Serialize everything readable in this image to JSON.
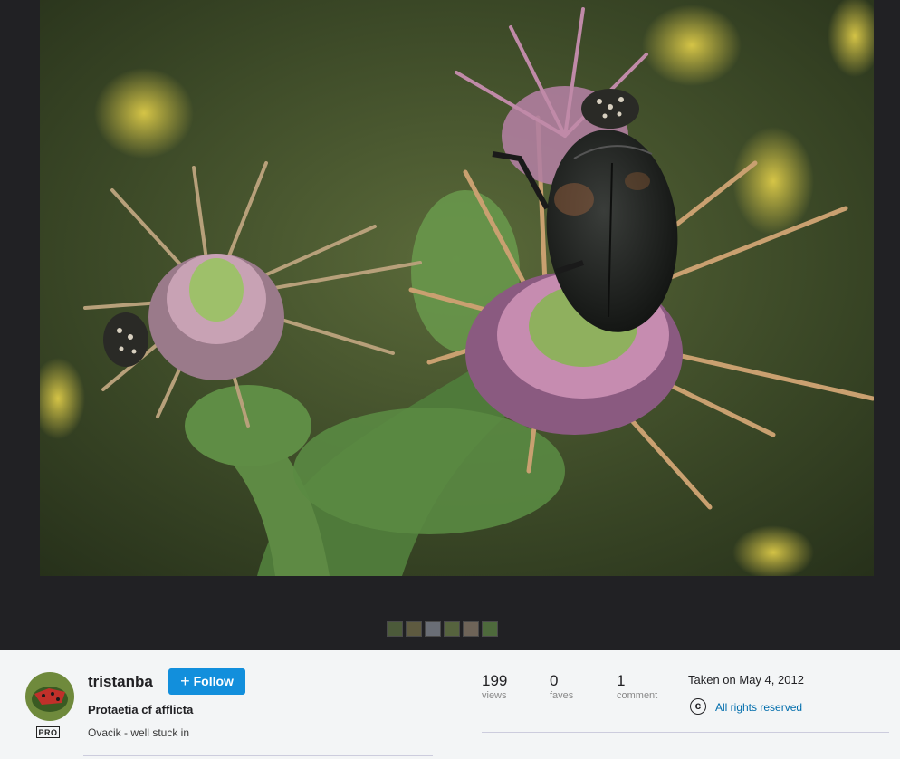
{
  "photo": {
    "alt_subject": "beetle on thistle"
  },
  "filmstrip": {
    "thumbnails": [
      {
        "color": "#4c5a3a"
      },
      {
        "color": "#5e5a40"
      },
      {
        "color": "#6a6e76"
      },
      {
        "color": "#56633e"
      },
      {
        "color": "#6e6458"
      },
      {
        "color": "#4e6a3c"
      }
    ]
  },
  "owner": {
    "username": "tristanba",
    "pro_badge": "PRO",
    "follow_label": "Follow"
  },
  "photo_info": {
    "title": "Protaetia cf afflicta",
    "description": "Ovacik - well stuck in"
  },
  "stats": {
    "views": {
      "value": "199",
      "label": "views"
    },
    "faves": {
      "value": "0",
      "label": "faves"
    },
    "comments": {
      "value": "1",
      "label": "comment"
    }
  },
  "meta": {
    "taken": "Taken on May 4, 2012",
    "license": "All rights reserved",
    "license_icon": "copyright-icon"
  },
  "colors": {
    "accent": "#128fdc",
    "link": "#006dac",
    "viewer_bg": "#212124"
  }
}
